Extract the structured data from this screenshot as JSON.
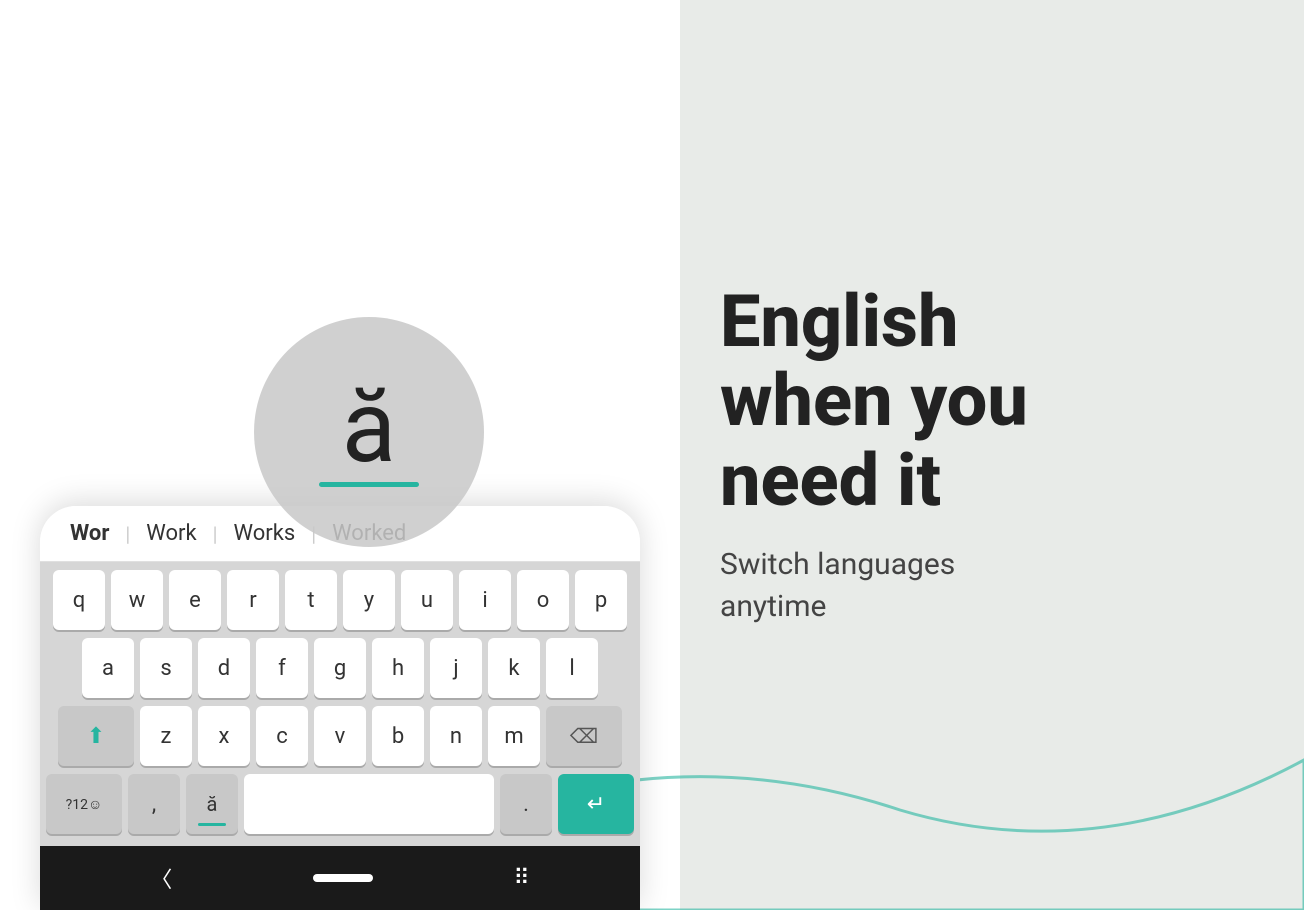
{
  "left_panel": {
    "suggestions": [
      "Wor",
      "Work",
      "Works",
      "Worked"
    ],
    "row1_keys": [
      "q",
      "w",
      "e",
      "r",
      "t",
      "y",
      "u",
      "i",
      "o",
      "p"
    ],
    "row2_keys": [
      "a",
      "s",
      "d",
      "f",
      "g",
      "h",
      "j",
      "k",
      "l"
    ],
    "row3_keys": [
      "z",
      "x",
      "c",
      "v",
      "b",
      "n",
      "m"
    ],
    "bottom_keys": {
      "num": "?12☺",
      "comma": ",",
      "abreve": "ă",
      "period": ".",
      "enter": "↵"
    },
    "popup_char": "ă"
  },
  "right_panel": {
    "headline": "English\nwhen you\nneed it",
    "subtext": "Switch languages\nanytime"
  },
  "nav_bar": {
    "back_label": "‹",
    "home_label": "",
    "apps_label": "⠿"
  }
}
